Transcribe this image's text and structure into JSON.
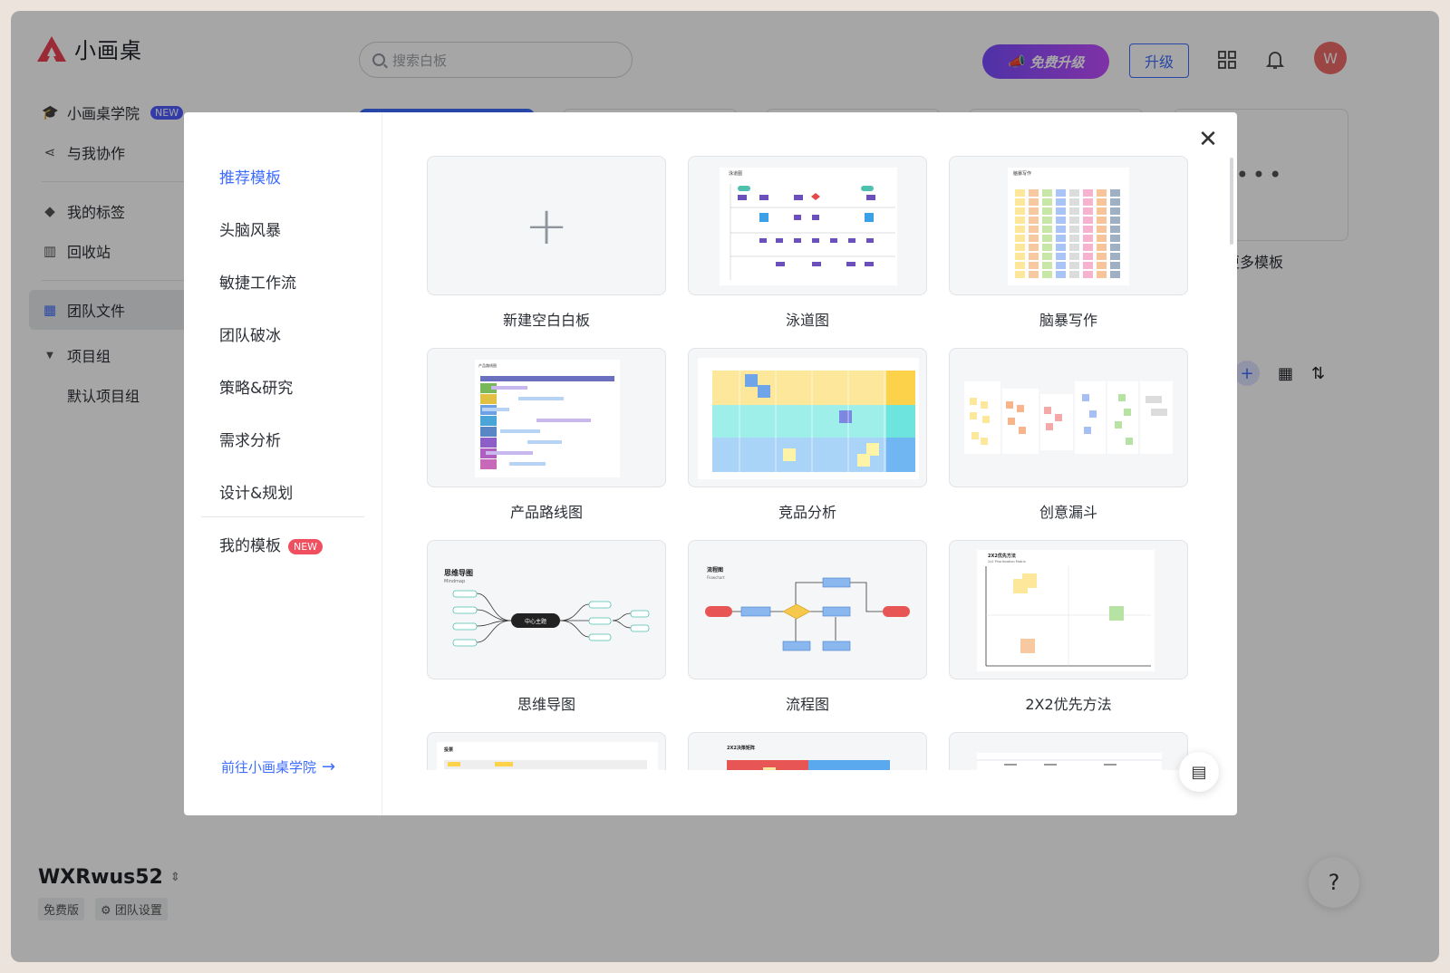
{
  "app": {
    "name": "小画桌",
    "search_placeholder": "搜索白板",
    "promo_label": "免费升级",
    "upgrade_label": "升级",
    "avatar_initial": "W"
  },
  "sidebar": {
    "items": [
      {
        "label": "小画桌学院",
        "badge": "NEW",
        "icon": "graduation-cap-icon"
      },
      {
        "label": "与我协作",
        "icon": "share-icon"
      },
      {
        "label": "我的标签",
        "icon": "tag-icon"
      },
      {
        "label": "回收站",
        "icon": "trash-icon"
      },
      {
        "label": "团队文件",
        "icon": "grid-icon"
      },
      {
        "label": "项目组",
        "icon": "caret-down-icon"
      },
      {
        "label": "默认项目组",
        "icon": ""
      }
    ]
  },
  "team": {
    "name": "WXRwus52",
    "plan": "免费版",
    "settings_label": "团队设置"
  },
  "background": {
    "more_templates_label": "更多模板"
  },
  "modal": {
    "categories": [
      {
        "label": "推荐模板",
        "active": true
      },
      {
        "label": "头脑风暴"
      },
      {
        "label": "敏捷工作流"
      },
      {
        "label": "团队破冰"
      },
      {
        "label": "策略&研究"
      },
      {
        "label": "需求分析"
      },
      {
        "label": "设计&规划"
      }
    ],
    "my_templates": {
      "label": "我的模板",
      "badge": "NEW"
    },
    "academy_link": "前往小画桌学院",
    "templates": [
      {
        "label": "新建空白白板",
        "preview": "blank"
      },
      {
        "label": "泳道图",
        "preview": "swimlane"
      },
      {
        "label": "脑暴写作",
        "preview": "brainwriting"
      },
      {
        "label": "产品路线图",
        "preview": "roadmap"
      },
      {
        "label": "竞品分析",
        "preview": "competitive"
      },
      {
        "label": "创意漏斗",
        "preview": "funnel"
      },
      {
        "label": "思维导图",
        "preview": "mindmap"
      },
      {
        "label": "流程图",
        "preview": "flowchart"
      },
      {
        "label": "2X2优先方法",
        "preview": "2x2"
      }
    ],
    "thumb_text": {
      "swimlane_title": "泳道图",
      "brainwriting_title": "脑暴写作",
      "roadmap_title": "产品路线图",
      "mindmap_title": "思维导图",
      "mindmap_sub": "Mindmap",
      "mindmap_center": "中心主题",
      "flowchart_title": "流程图",
      "flowchart_sub": "Flowchart",
      "twobytwo_title": "2X2优先方法",
      "twobytwo_sub": "2x2 Prioritization Matrix",
      "partial_title_1": "投票",
      "partial_title_2": "2X2决策矩阵"
    }
  },
  "colors": {
    "accent": "#3e6cff",
    "new_badge": "#ef4f5e",
    "avatar": "#f06a6a"
  }
}
